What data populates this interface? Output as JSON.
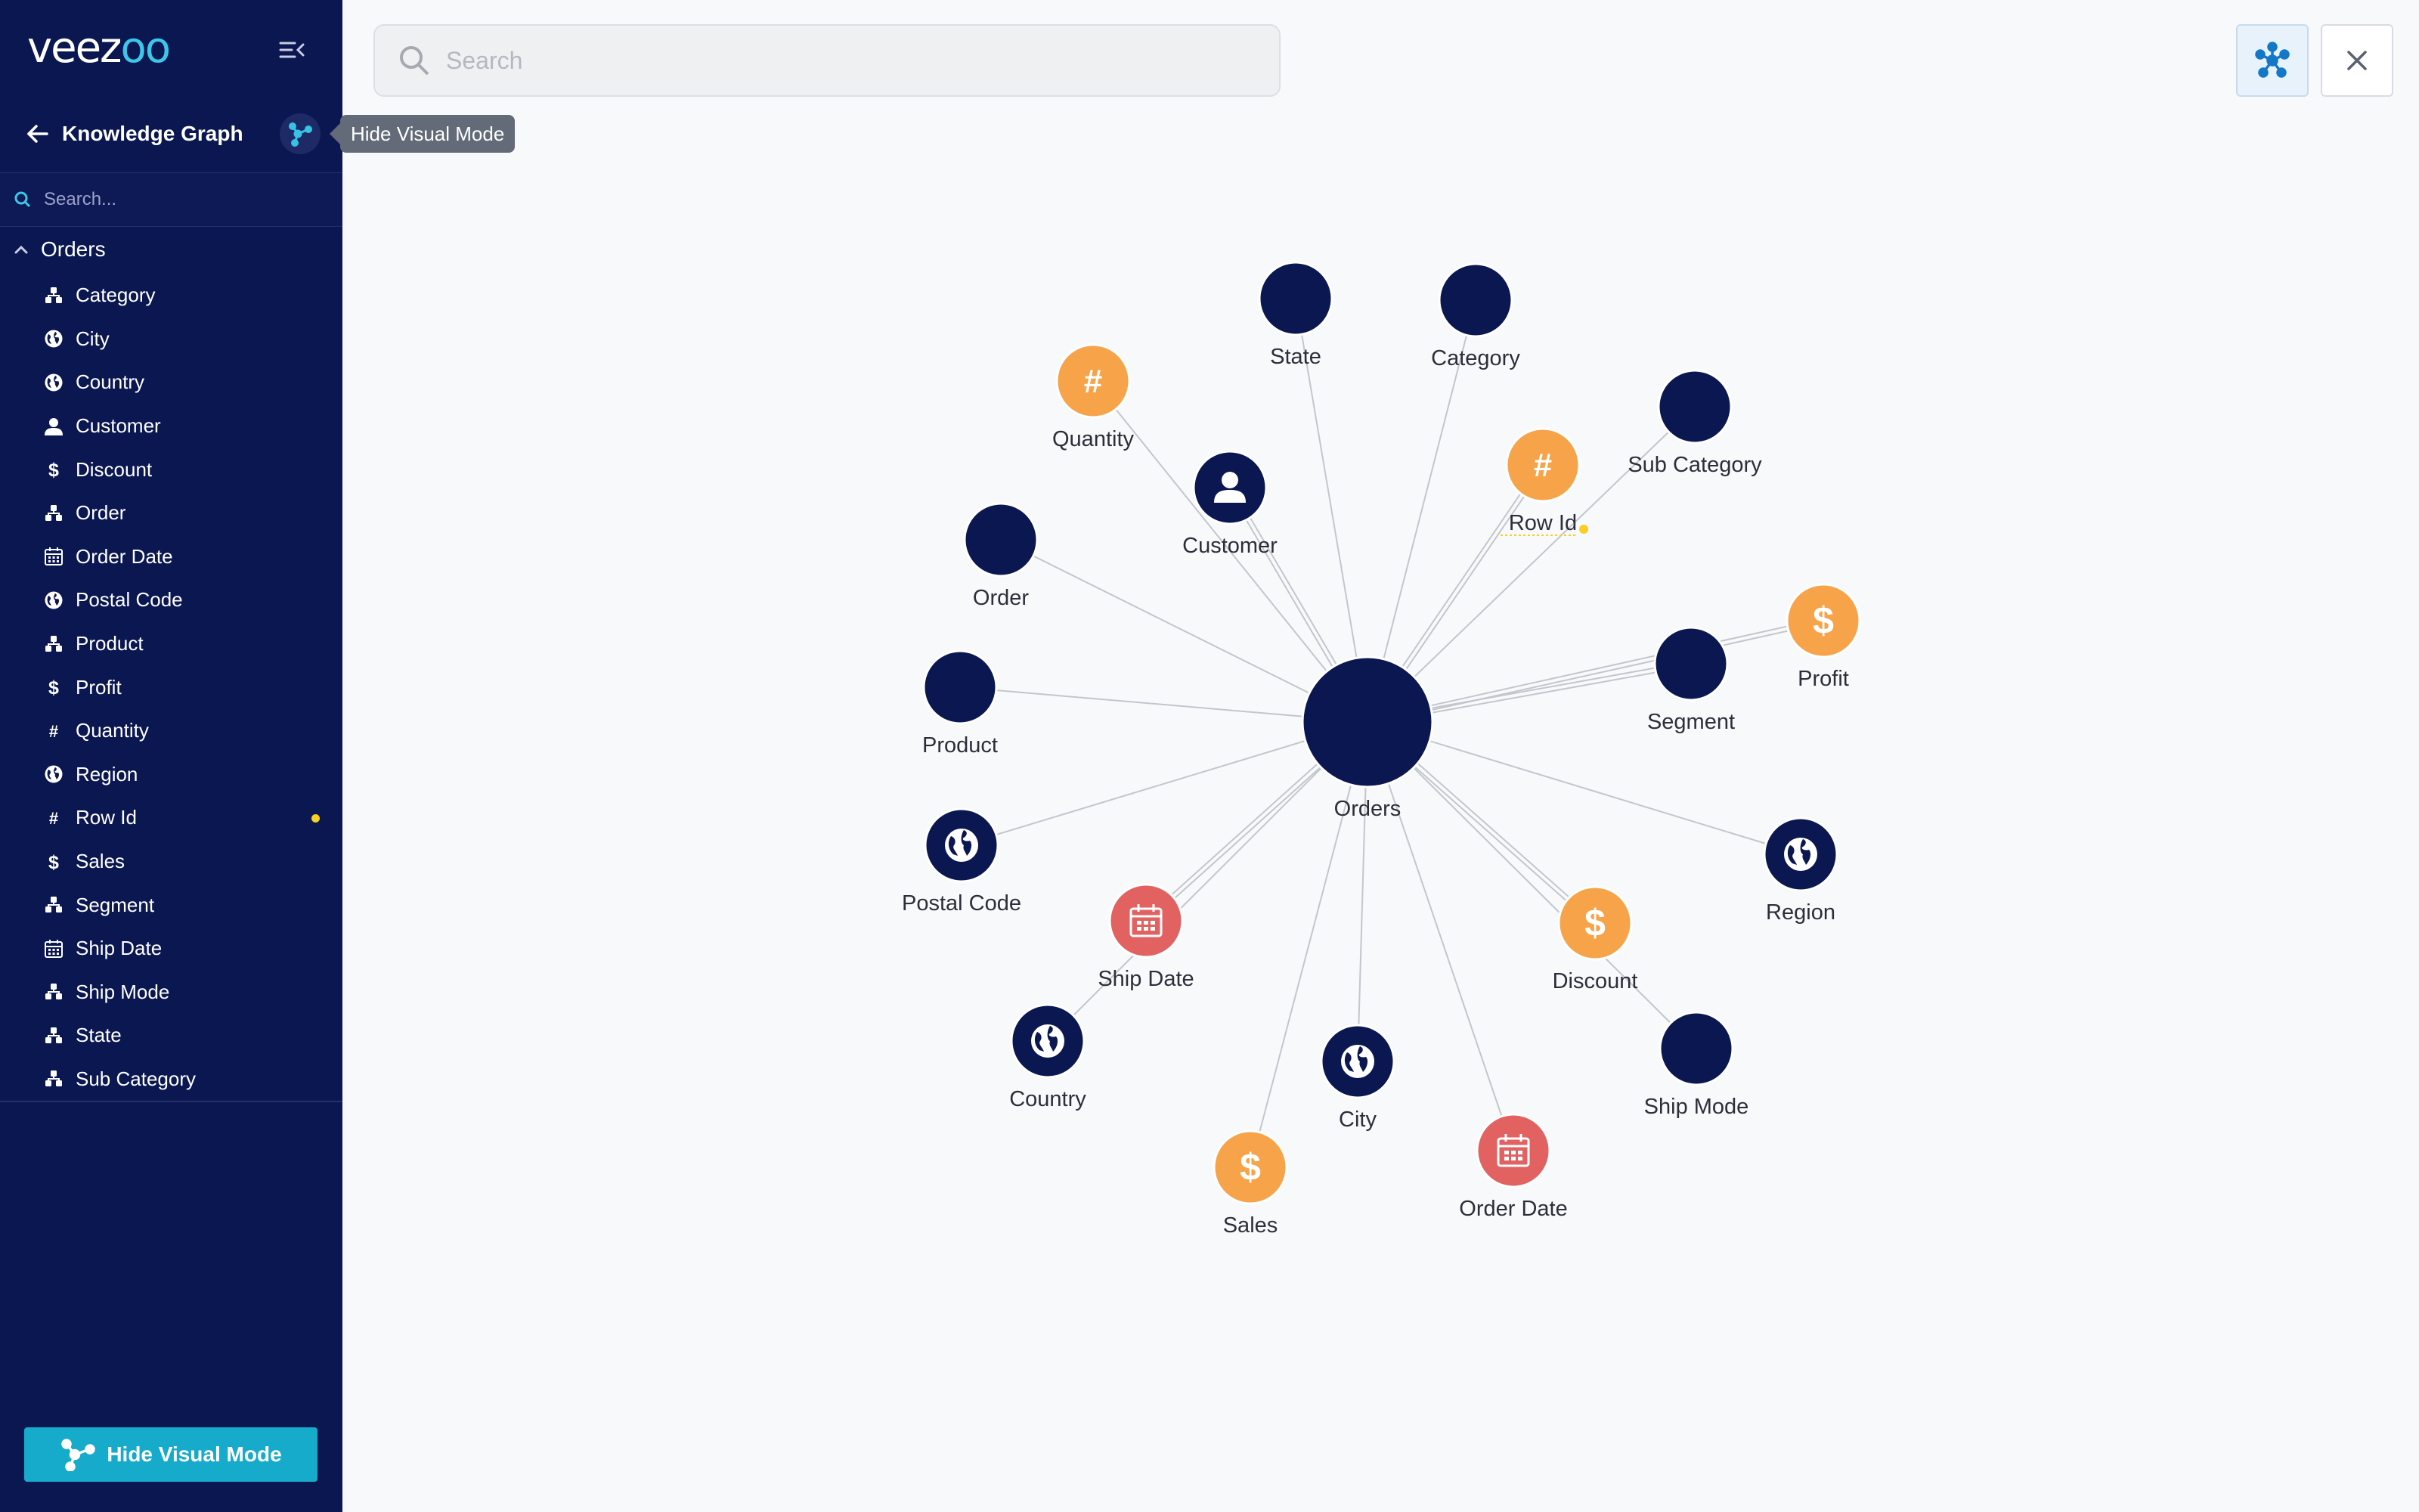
{
  "app": {
    "logo": "veezoo",
    "header_title": "Knowledge Graph",
    "tooltip": "Hide Visual Mode",
    "sidebar_search_placeholder": "Search...",
    "tree_root": "Orders",
    "hide_button_label": "Hide Visual Mode",
    "main_search_placeholder": "Search"
  },
  "colors": {
    "sidebar": "#0b1750",
    "node_dark": "#0b1750",
    "node_orange": "#f7a349",
    "node_red": "#e26262",
    "accent": "#16aacb",
    "status_dot": "#f7d022"
  },
  "tree_items": [
    {
      "label": "Category",
      "icon": "hierarchy-icon"
    },
    {
      "label": "City",
      "icon": "globe-icon"
    },
    {
      "label": "Country",
      "icon": "globe-icon"
    },
    {
      "label": "Customer",
      "icon": "person-icon"
    },
    {
      "label": "Discount",
      "icon": "dollar-icon"
    },
    {
      "label": "Order",
      "icon": "hierarchy-icon"
    },
    {
      "label": "Order Date",
      "icon": "calendar-icon"
    },
    {
      "label": "Postal Code",
      "icon": "globe-icon"
    },
    {
      "label": "Product",
      "icon": "hierarchy-icon"
    },
    {
      "label": "Profit",
      "icon": "dollar-icon"
    },
    {
      "label": "Quantity",
      "icon": "hash-icon"
    },
    {
      "label": "Region",
      "icon": "globe-icon"
    },
    {
      "label": "Row Id",
      "icon": "hash-icon",
      "flag": true
    },
    {
      "label": "Sales",
      "icon": "dollar-icon"
    },
    {
      "label": "Segment",
      "icon": "hierarchy-icon"
    },
    {
      "label": "Ship Date",
      "icon": "calendar-icon"
    },
    {
      "label": "Ship Mode",
      "icon": "hierarchy-icon"
    },
    {
      "label": "State",
      "icon": "hierarchy-icon"
    },
    {
      "label": "Sub Category",
      "icon": "hierarchy-icon"
    }
  ],
  "graph": {
    "center": {
      "label": "Orders"
    },
    "nodes": [
      {
        "label": "State",
        "kind": "plain"
      },
      {
        "label": "Category",
        "kind": "plain"
      },
      {
        "label": "Quantity",
        "kind": "hash"
      },
      {
        "label": "Customer",
        "kind": "person"
      },
      {
        "label": "Row Id",
        "kind": "hash",
        "flag": true
      },
      {
        "label": "Sub Category",
        "kind": "plain"
      },
      {
        "label": "Order",
        "kind": "plain"
      },
      {
        "label": "Profit",
        "kind": "dollar"
      },
      {
        "label": "Segment",
        "kind": "plain"
      },
      {
        "label": "Product",
        "kind": "plain"
      },
      {
        "label": "Postal Code",
        "kind": "globe"
      },
      {
        "label": "Region",
        "kind": "globe"
      },
      {
        "label": "Ship Date",
        "kind": "calendar"
      },
      {
        "label": "Discount",
        "kind": "dollar"
      },
      {
        "label": "Country",
        "kind": "globe"
      },
      {
        "label": "City",
        "kind": "globe"
      },
      {
        "label": "Ship Mode",
        "kind": "plain"
      },
      {
        "label": "Order Date",
        "kind": "calendar"
      },
      {
        "label": "Sales",
        "kind": "dollar"
      }
    ]
  }
}
